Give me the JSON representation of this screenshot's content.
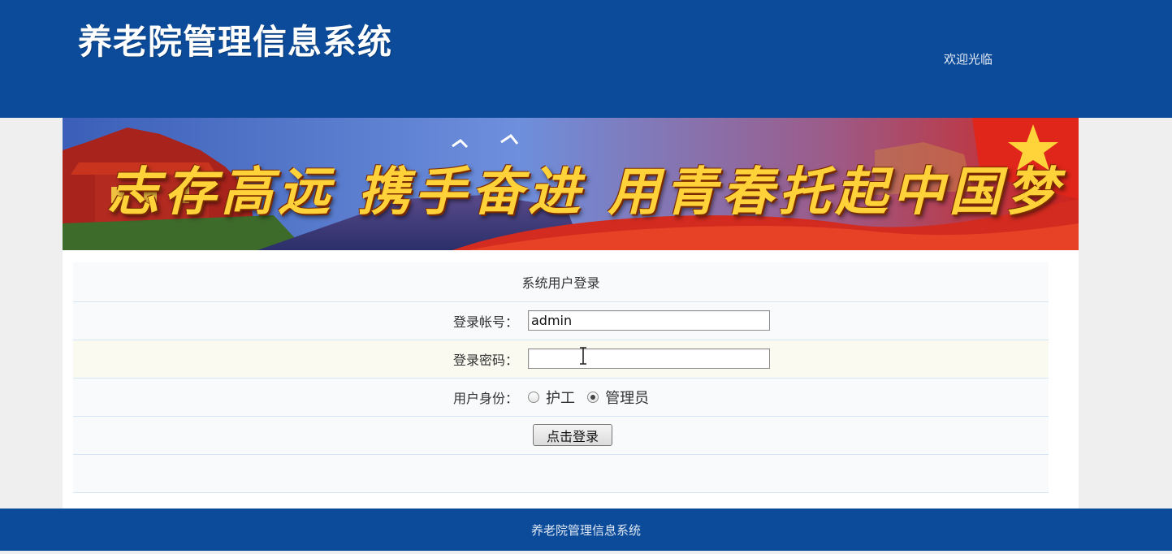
{
  "header": {
    "title": "养老院管理信息系统",
    "welcome": "欢迎光临"
  },
  "banner": {
    "slogan": "志存高远 携手奋进 用青春托起中国梦"
  },
  "login": {
    "title": "系统用户登录",
    "account_label": "登录帐号：",
    "account_value": "admin",
    "password_label": "登录密码：",
    "password_value": "",
    "role_label": "用户身份：",
    "roles": [
      {
        "label": "护工",
        "checked": false
      },
      {
        "label": "管理员",
        "checked": true
      }
    ],
    "submit_label": "点击登录"
  },
  "footer": {
    "text": "养老院管理信息系统"
  },
  "colors": {
    "brand_blue": "#0b4b9a",
    "row_border": "#d6e6f4",
    "highlight_row": "#fafaf0"
  }
}
